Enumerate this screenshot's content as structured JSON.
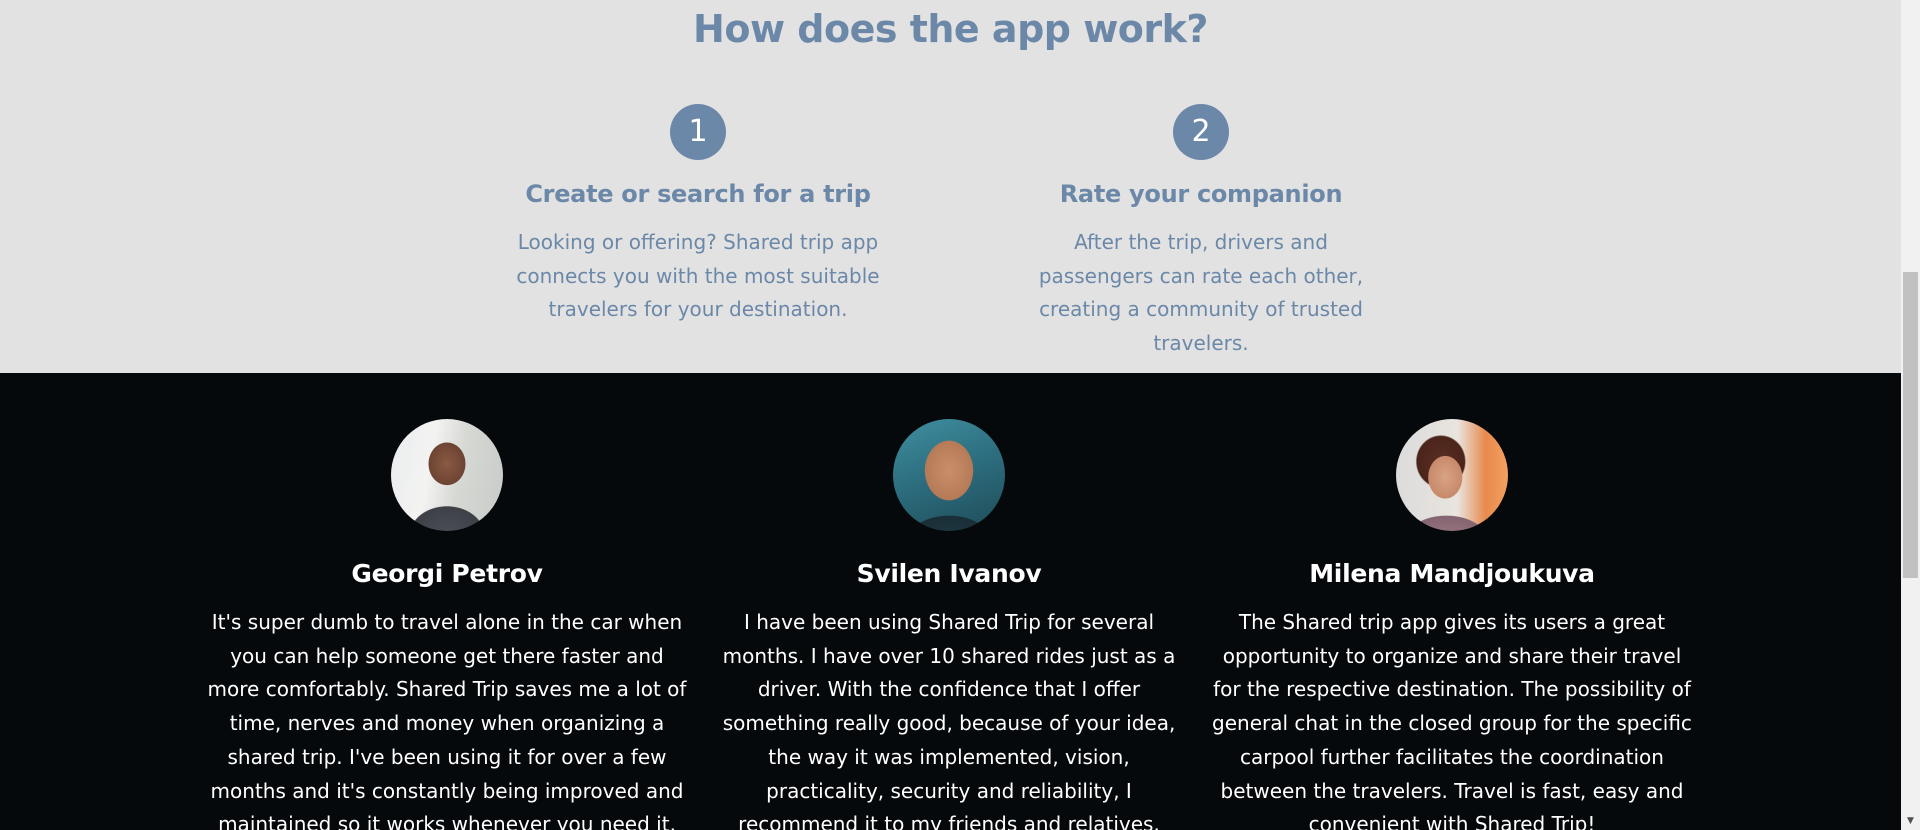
{
  "how_it_works": {
    "title": "How does the app work?",
    "accent_color": "#6b88a8",
    "background": "#e2e2e2",
    "steps": [
      {
        "number": "1",
        "title": "Create or search for a trip",
        "text": "Looking or offering? Shared trip app connects you with the most suitable travelers for your destination."
      },
      {
        "number": "2",
        "title": "Rate your companion",
        "text": "After the trip, drivers and passengers can rate each other, creating a community of trusted travelers."
      }
    ]
  },
  "testimonials": {
    "background": "#06090c",
    "items": [
      {
        "name": "Georgi Petrov",
        "quote": "It's super dumb to travel alone in the car when you can help someone get there faster and more comfortably. Shared Trip saves me a lot of time, nerves and money when organizing a shared trip. I've been using it for over a few months and it's constantly being improved and maintained so it works whenever you need it."
      },
      {
        "name": "Svilen Ivanov",
        "quote": "I have been using Shared Trip for several months. I have over 10 shared rides just as a driver. With the confidence that I offer something really good, because of your idea, the way it was implemented, vision, practicality, security and reliability, I recommend it to my friends and relatives."
      },
      {
        "name": "Milena Mandjoukuva",
        "quote": "The Shared trip app gives its users a great opportunity to organize and share their travel for the respective destination. The possibility of general chat in the closed group for the specific carpool further facilitates the coordination between the travelers. Travel is fast, easy and convenient with Shared Trip!"
      }
    ]
  },
  "scrollbar": {
    "scroll_arrow_icon": "chevron-down-icon"
  }
}
